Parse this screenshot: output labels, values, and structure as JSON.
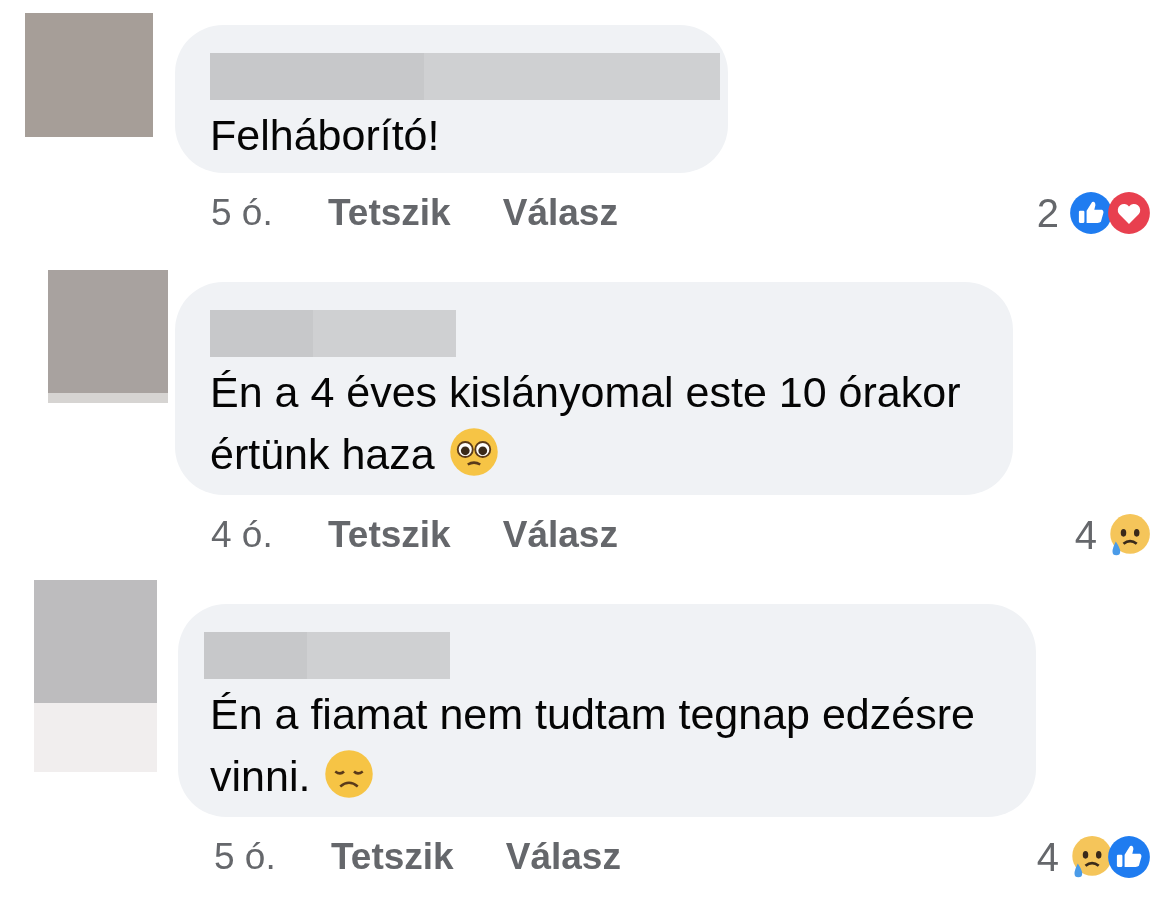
{
  "comments": [
    {
      "avatar": {
        "kind": "grey"
      },
      "text": "Felháborító!",
      "time": "5 ó.",
      "actions": [
        "Tetszik",
        "Válasz"
      ],
      "reaction_count": "2",
      "reactions": [
        {
          "kind": "like"
        },
        {
          "kind": "love"
        }
      ]
    },
    {
      "avatar": {
        "kind": "grey"
      },
      "text": "Én a 4 éves kislányomal este 10 órakor értünk haza",
      "emoji": {
        "kind": "pleading"
      },
      "time": "4 ó.",
      "actions": [
        "Tetszik",
        "Válasz"
      ],
      "reaction_count": "4",
      "reactions": [
        {
          "kind": "sad"
        }
      ]
    },
    {
      "avatar": {
        "kind": "split"
      },
      "text": "Én a fiamat nem tudtam tegnap edzésre vinni.",
      "emoji": {
        "kind": "disappointed"
      },
      "time": "5 ó.",
      "actions": [
        "Tetszik",
        "Válasz"
      ],
      "reaction_count": "4",
      "reactions": [
        {
          "kind": "sad"
        },
        {
          "kind": "like"
        }
      ]
    }
  ]
}
